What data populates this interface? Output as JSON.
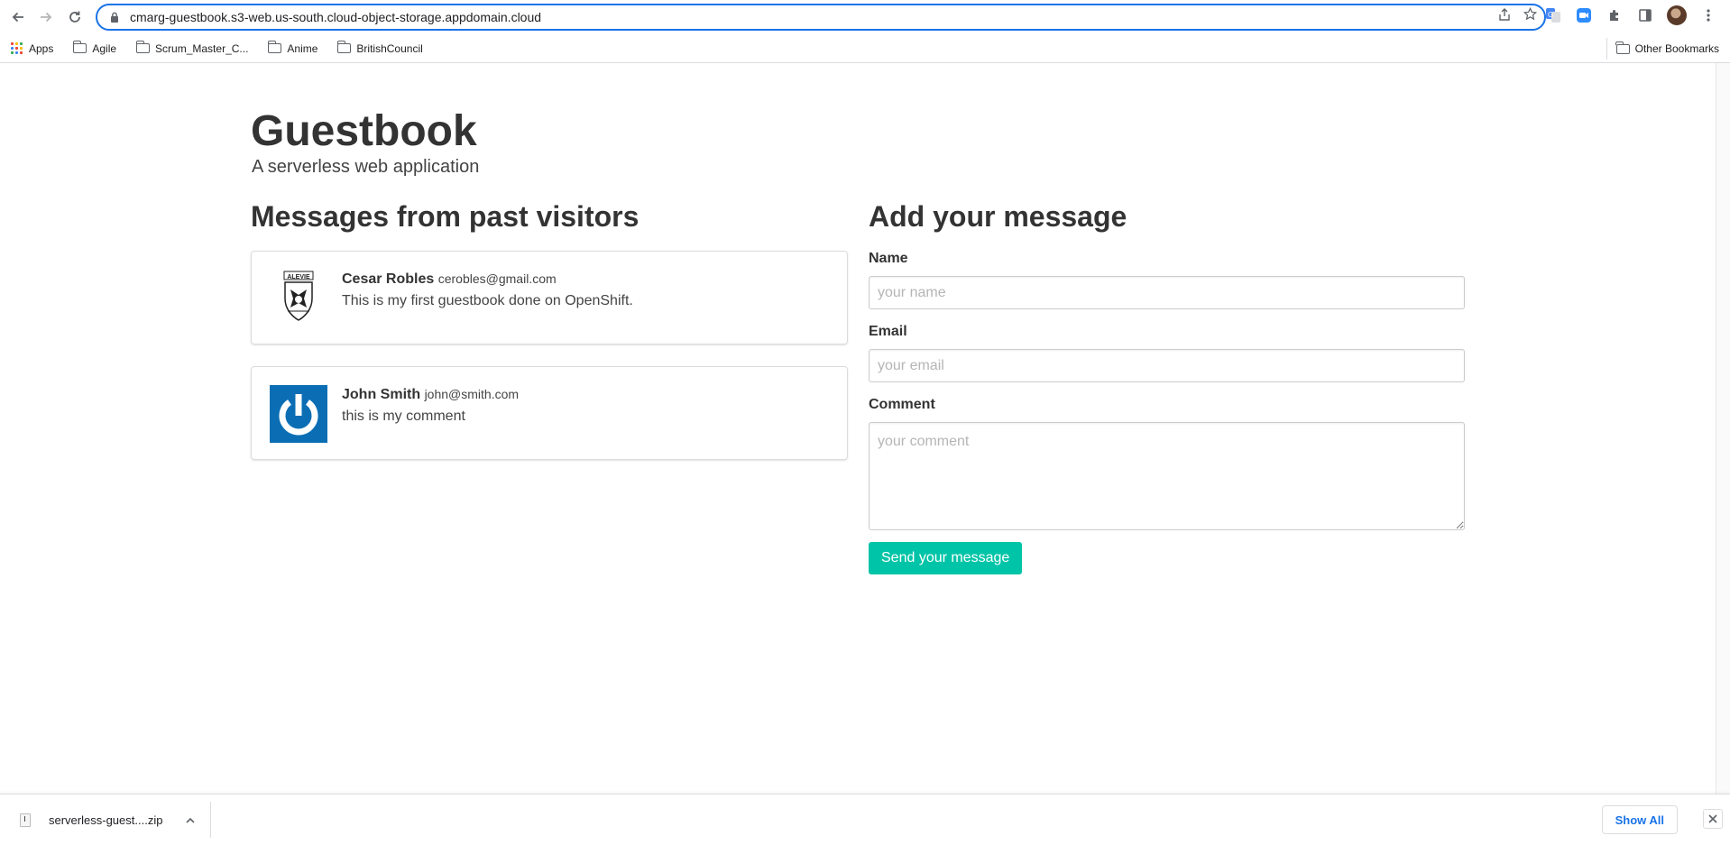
{
  "browser": {
    "url": "cmarg-guestbook.s3-web.us-south.cloud-object-storage.appdomain.cloud",
    "bookmarks": [
      {
        "label": "Apps",
        "icon": "apps-grid-icon"
      },
      {
        "label": "Agile",
        "icon": "folder-icon"
      },
      {
        "label": "Scrum_Master_C...",
        "icon": "folder-icon"
      },
      {
        "label": "Anime",
        "icon": "folder-icon"
      },
      {
        "label": "BritishCouncil",
        "icon": "folder-icon"
      }
    ],
    "other_bookmarks": "Other Bookmarks"
  },
  "page": {
    "title": "Guestbook",
    "subtitle": "A serverless web application"
  },
  "messages": {
    "heading": "Messages from past visitors",
    "entries": [
      {
        "name": "Cesar Robles",
        "email": "cerobles@gmail.com",
        "comment": "This is my first guestbook done on OpenShift.",
        "avatar": "alevie-crest-icon"
      },
      {
        "name": "John Smith",
        "email": "john@smith.com",
        "comment": "this is my comment",
        "avatar": "power-symbol-icon"
      }
    ]
  },
  "form": {
    "heading": "Add your message",
    "name_label": "Name",
    "name_placeholder": "your name",
    "email_label": "Email",
    "email_placeholder": "your email",
    "comment_label": "Comment",
    "comment_placeholder": "your comment",
    "submit_label": "Send your message"
  },
  "downloads": {
    "file_name": "serverless-guest....zip",
    "show_all": "Show All"
  },
  "colors": {
    "accent": "#00c4a7",
    "chrome_blue": "#1a73e8",
    "avatar_blue": "#0b6eb4"
  }
}
